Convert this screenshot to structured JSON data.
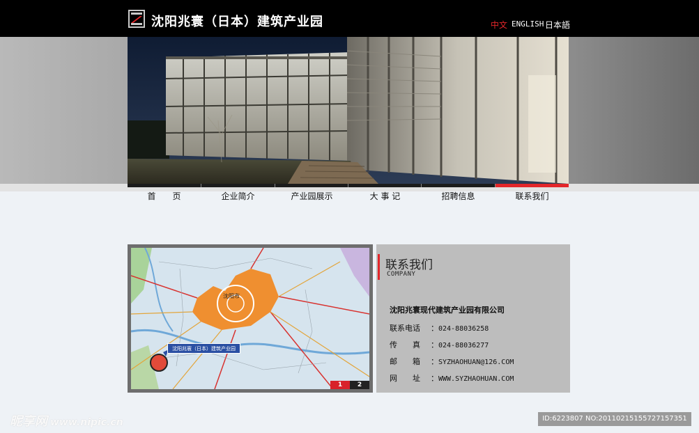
{
  "header": {
    "logo_text": "沈阳兆寰（日本）建筑产业园",
    "languages": [
      {
        "label": "中文",
        "active": true
      },
      {
        "label": "ENGLISH",
        "active": false
      },
      {
        "label": "日本語",
        "active": false
      }
    ]
  },
  "nav": {
    "items": [
      {
        "label": "首　　页"
      },
      {
        "label": "企业简介"
      },
      {
        "label": "产业园展示"
      },
      {
        "label": "大 事 记"
      },
      {
        "label": "招聘信息"
      },
      {
        "label": "联系我们",
        "active": true
      }
    ]
  },
  "map": {
    "city_label": "沈阳市",
    "callout": "沈阳兆寰（日本）建筑产业园",
    "pages": [
      "1",
      "2"
    ]
  },
  "contact": {
    "title": "联系我们",
    "subtitle": "COMPANY",
    "company": "沈阳兆寰现代建筑产业园有限公司",
    "rows": [
      {
        "key": "联系电话",
        "value": "024-88036258"
      },
      {
        "key": "传　　真",
        "value": "024-88036277"
      },
      {
        "key": "邮　　箱",
        "value": "SYZHAOHUAN@126.COM"
      },
      {
        "key": "网　　址",
        "value": "WWW.SYZHAOHUAN.COM"
      }
    ]
  },
  "watermark": {
    "brand": "昵享网",
    "site": "www.nipic.cn",
    "id_text": "ID:6223807 NO:20110215155727157351"
  },
  "colors": {
    "accent": "#e3262a",
    "topbar": "#000000",
    "page_bg": "#eef2f6",
    "panel_gray": "#bdbdbd"
  }
}
